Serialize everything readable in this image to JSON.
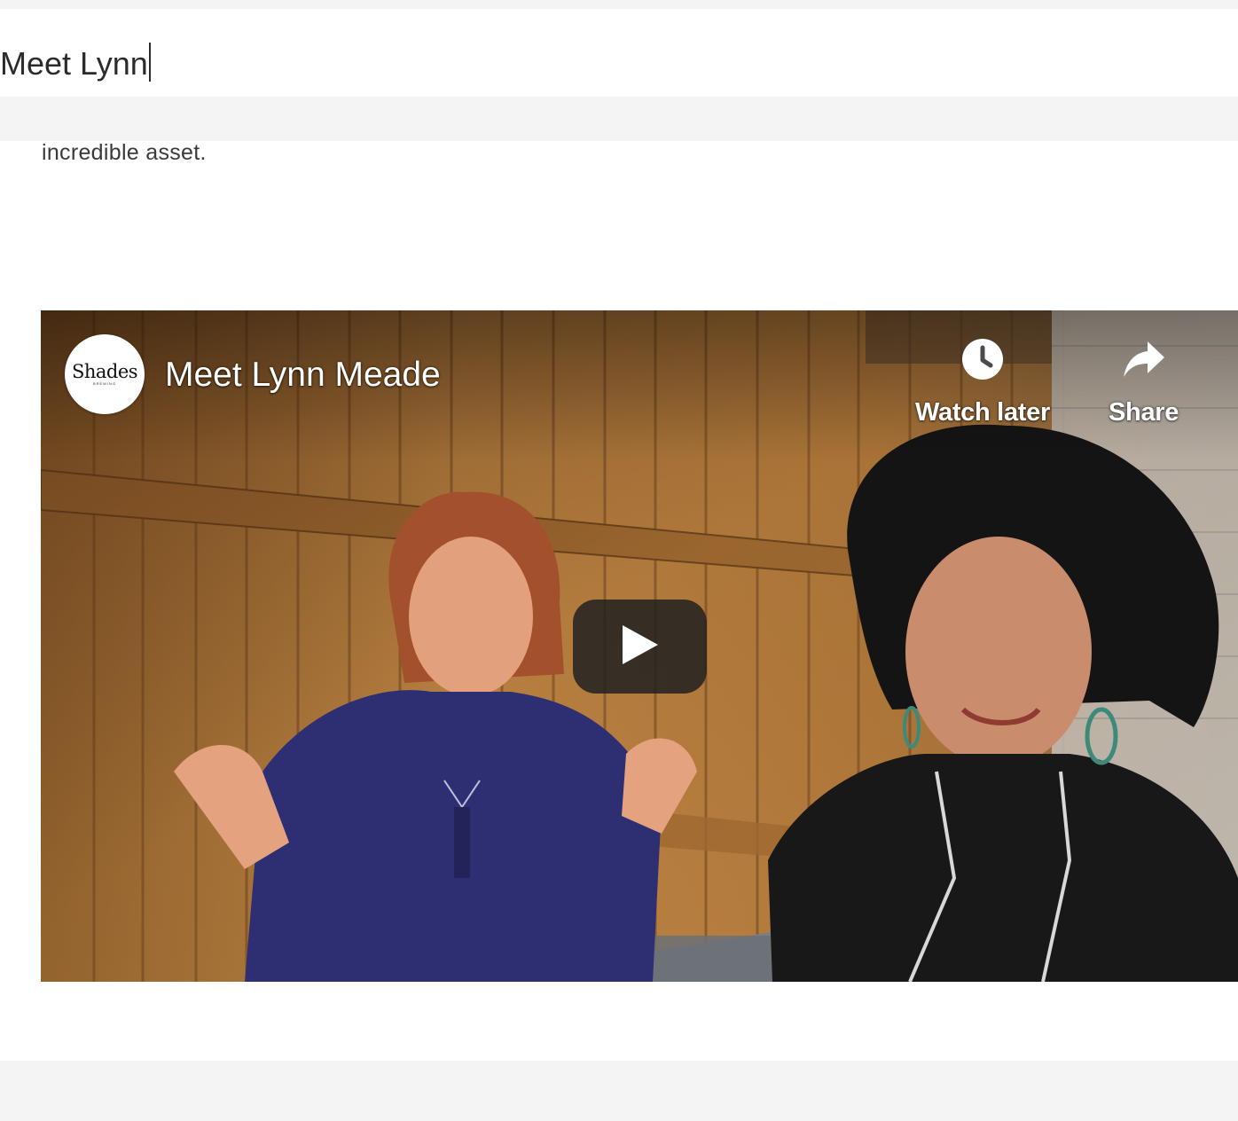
{
  "editor": {
    "title_value": "Meet Lynn"
  },
  "body": {
    "text": "incredible asset."
  },
  "video": {
    "title": "Meet Lynn Meade",
    "channel_logo_text": "Shades",
    "channel_logo_subtext": "BREWING",
    "watch_later_label": "Watch later",
    "share_label": "Share",
    "icons": {
      "watch_later": "clock-icon",
      "share": "share-arrow-icon",
      "play": "play-icon"
    }
  },
  "colors": {
    "page_bg": "#f4f4f4",
    "content_bg": "#ffffff",
    "text": "#2b2b2b",
    "play_button_bg": "#212121"
  }
}
